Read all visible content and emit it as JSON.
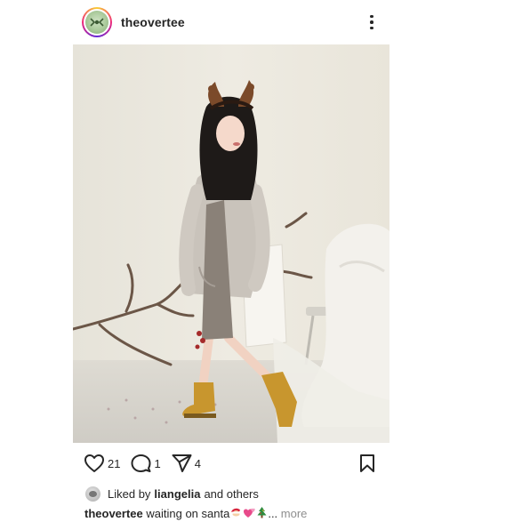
{
  "post": {
    "username": "theovertee",
    "likes_prefix": "Liked by",
    "liked_by_user": "liangelia",
    "likes_suffix": "and others",
    "caption_user": "theovertee",
    "caption_text": "waiting on santa",
    "caption_emojis": [
      "santa-emoji",
      "two-hearts-emoji",
      "christmas-tree-emoji"
    ],
    "ellipsis": "...",
    "more_label": "more"
  },
  "actions": {
    "like_count": "21",
    "comment_count": "1",
    "share_count": "4"
  },
  "colors": {
    "text": "#262626",
    "muted": "#8e8e8e",
    "icon": "#262626"
  }
}
